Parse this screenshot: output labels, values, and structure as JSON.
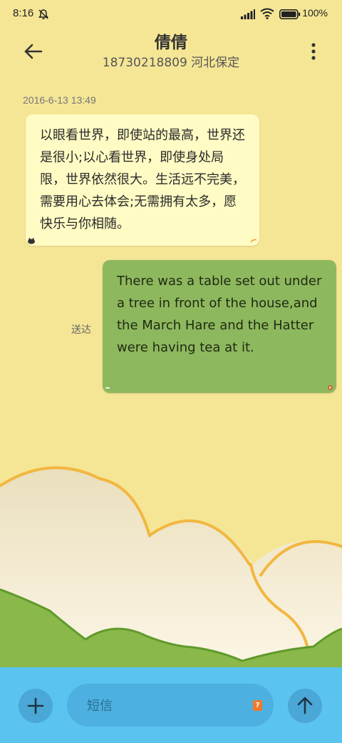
{
  "status_bar": {
    "time": "8:16",
    "battery_percent": "100%",
    "icons": [
      "bell-muted-icon",
      "signal-icon",
      "wifi-icon",
      "battery-icon"
    ]
  },
  "header": {
    "contact_name": "倩倩",
    "contact_detail": "18730218809 河北保定",
    "icons": [
      "back-arrow-icon",
      "more-vert-icon"
    ]
  },
  "conversation": {
    "timestamp": "2016-6-13 13:49",
    "messages": [
      {
        "direction": "incoming",
        "text": "以眼看世界，即使站的最高，世界还是很小;以心看世界，即使身处局限，世界依然很大。生活远不完美，需要用心去体会;无需拥有太多，愿快乐与你相随。"
      },
      {
        "direction": "outgoing",
        "text": "There was a table set out under a tree in front of the house,and the March Hare and the Hatter were having tea at it.",
        "status": "送达"
      }
    ]
  },
  "composer": {
    "placeholder": "短信",
    "sim_badge": "?",
    "icons": [
      "plus-icon",
      "send-arrow-icon"
    ]
  },
  "colors": {
    "background": "#f5e696",
    "incoming_bubble": "#fffbc4",
    "outgoing_bubble": "#8eb85e",
    "input_bar": "#5ac3ef",
    "cloud_outline": "#f2b740",
    "hill_green": "#8ab84a"
  }
}
